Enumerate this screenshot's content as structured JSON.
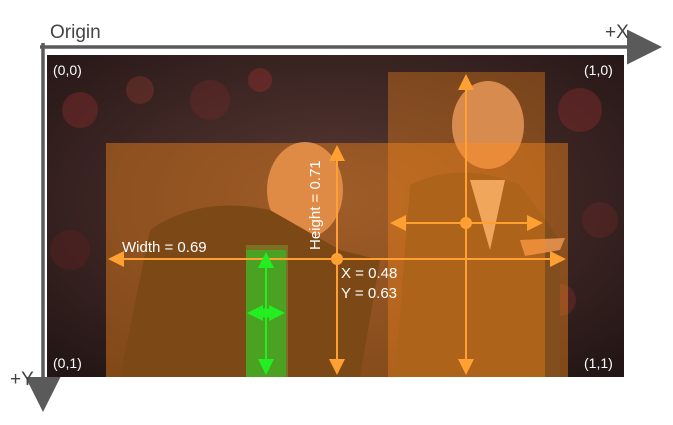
{
  "axes": {
    "origin_label": "Origin",
    "x_label": "+X",
    "y_label": "+Y"
  },
  "corners": {
    "top_left": "(0,0)",
    "top_right": "(1,0)",
    "bottom_left": "(0,1)",
    "bottom_right": "(1,1)"
  },
  "box_annotations": {
    "width_label": "Width = 0.69",
    "height_label": "Height = 0.71",
    "x_label": "X = 0.48",
    "y_label": "Y = 0.63"
  },
  "colors": {
    "axis": "#5a5a5a",
    "box_fill": "#ff8c1a",
    "box_line": "#ffa033",
    "small_box": "#22cc22",
    "corner_text": "#ffffff"
  }
}
